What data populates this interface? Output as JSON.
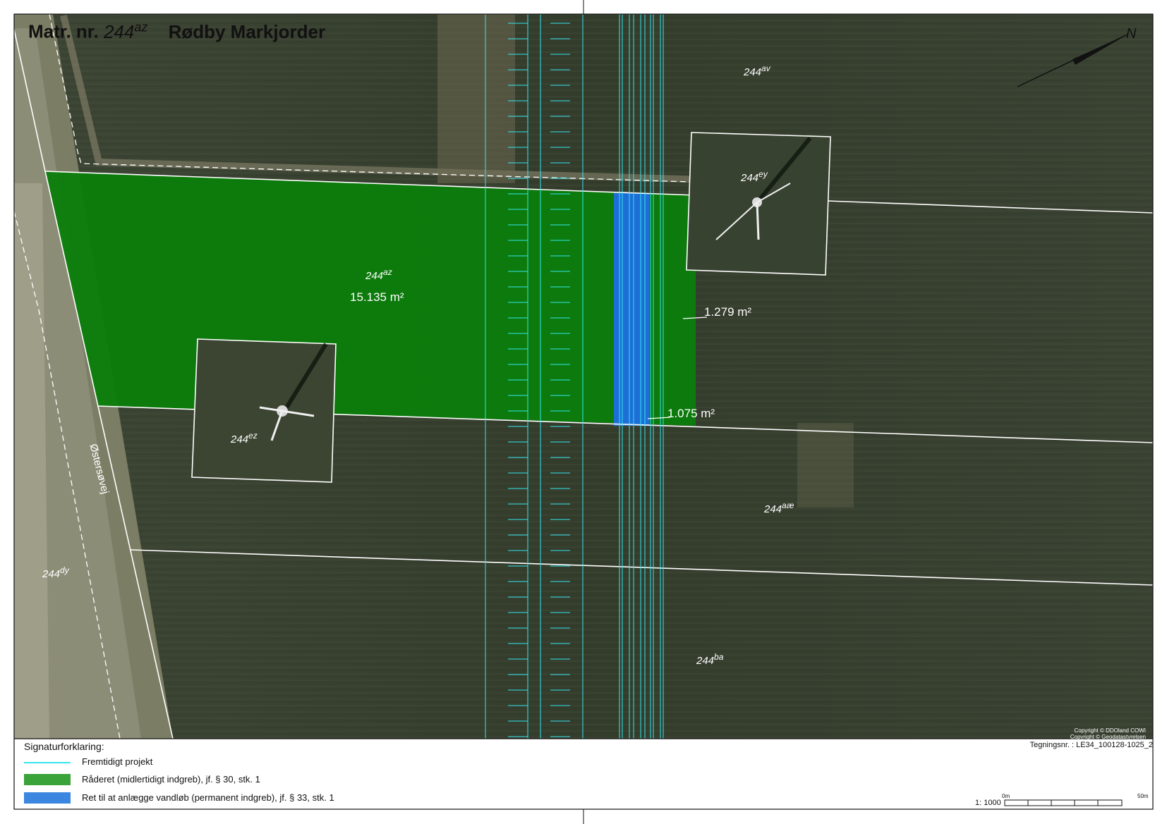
{
  "title": {
    "prefix": "Matr. nr.",
    "number": "244",
    "suffix": "az",
    "place": "Rødby Markjorder"
  },
  "parcels": [
    {
      "id": "av",
      "number": "244",
      "suffix": "av"
    },
    {
      "id": "ey",
      "number": "244",
      "suffix": "ey"
    },
    {
      "id": "az",
      "number": "244",
      "suffix": "az"
    },
    {
      "id": "ez",
      "number": "244",
      "suffix": "ez"
    },
    {
      "id": "ae",
      "number": "244",
      "suffix": "aæ"
    },
    {
      "id": "dy",
      "number": "244",
      "suffix": "dy"
    },
    {
      "id": "ba",
      "number": "244",
      "suffix": "ba"
    }
  ],
  "areas": {
    "main": "15.135 m²",
    "upper": "1.279 m²",
    "lower": "1.075 m²"
  },
  "road_name": "Østersøvej",
  "copyright": [
    "Copyright © DDOland COWI",
    "Copyright © Geodatastyrelsen"
  ],
  "drawing_number": "Tegningsnr. : LE34_100128-1025_2",
  "north_label": "N",
  "scale": {
    "ratio": "1: 1000",
    "start_label": "0m",
    "end_label": "50m"
  },
  "legend": {
    "heading": "Signaturforklaring:",
    "items": [
      {
        "label": "Fremtidigt projekt",
        "color": "#34e6ee",
        "kind": "line"
      },
      {
        "label": "Råderet (midlertidigt indgreb), jf. § 30, stk. 1",
        "color": "#3aa33a",
        "kind": "fill"
      },
      {
        "label": "Ret til at anlægge vandløb (permanent indgreb), jf. § 33, stk. 1",
        "color": "#3b86e0",
        "kind": "fill"
      }
    ]
  },
  "colors": {
    "future_project": "#34e6ee",
    "temporary_area": "#0b7d0b",
    "permanent_area": "#1d6fd6",
    "field": "#37402e",
    "boundary": "#ffffff"
  }
}
